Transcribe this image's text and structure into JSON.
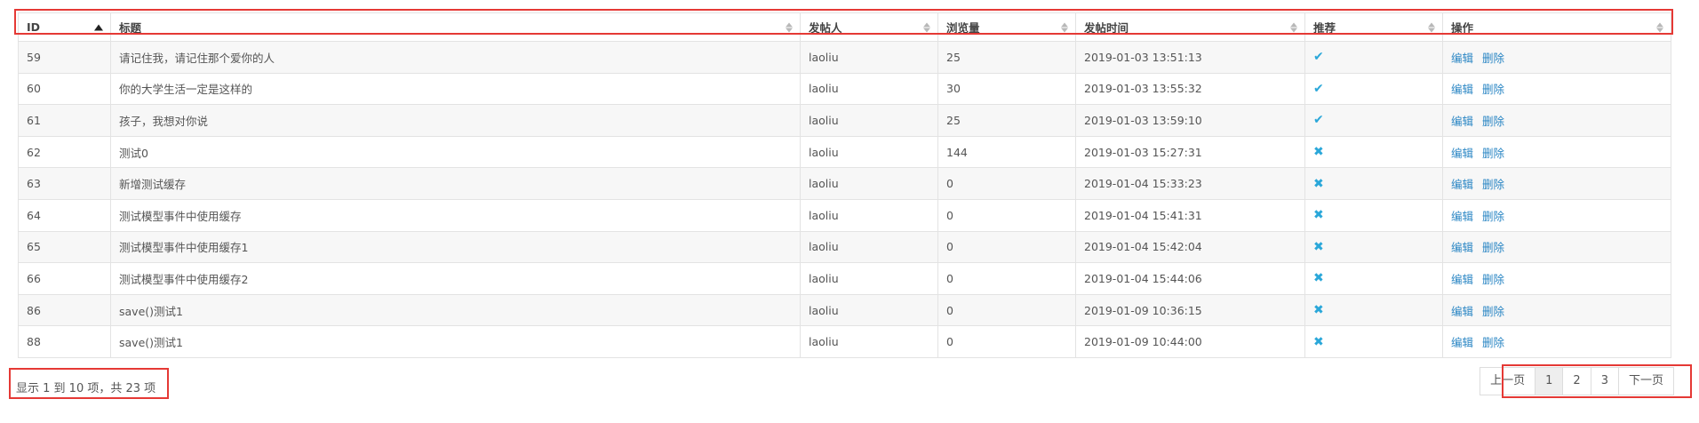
{
  "table": {
    "columns": [
      {
        "label": "ID",
        "sort": "asc"
      },
      {
        "label": "标题",
        "sort": "both"
      },
      {
        "label": "发帖人",
        "sort": "both"
      },
      {
        "label": "浏览量",
        "sort": "both"
      },
      {
        "label": "发帖时间",
        "sort": "both"
      },
      {
        "label": "推荐",
        "sort": "both"
      },
      {
        "label": "操作",
        "sort": "both"
      }
    ],
    "rows": [
      {
        "id": "59",
        "title": "请记住我，请记住那个爱你的人",
        "author": "laoliu",
        "views": "25",
        "time": "2019-01-03 13:51:13",
        "recommended": true
      },
      {
        "id": "60",
        "title": "你的大学生活一定是这样的",
        "author": "laoliu",
        "views": "30",
        "time": "2019-01-03 13:55:32",
        "recommended": true
      },
      {
        "id": "61",
        "title": "孩子，我想对你说",
        "author": "laoliu",
        "views": "25",
        "time": "2019-01-03 13:59:10",
        "recommended": true
      },
      {
        "id": "62",
        "title": "测试0",
        "author": "laoliu",
        "views": "144",
        "time": "2019-01-03 15:27:31",
        "recommended": false
      },
      {
        "id": "63",
        "title": "新增测试缓存",
        "author": "laoliu",
        "views": "0",
        "time": "2019-01-04 15:33:23",
        "recommended": false
      },
      {
        "id": "64",
        "title": "测试模型事件中使用缓存",
        "author": "laoliu",
        "views": "0",
        "time": "2019-01-04 15:41:31",
        "recommended": false
      },
      {
        "id": "65",
        "title": "测试模型事件中使用缓存1",
        "author": "laoliu",
        "views": "0",
        "time": "2019-01-04 15:42:04",
        "recommended": false
      },
      {
        "id": "66",
        "title": "测试模型事件中使用缓存2",
        "author": "laoliu",
        "views": "0",
        "time": "2019-01-04 15:44:06",
        "recommended": false
      },
      {
        "id": "86",
        "title": "save()测试1",
        "author": "laoliu",
        "views": "0",
        "time": "2019-01-09 10:36:15",
        "recommended": false
      },
      {
        "id": "88",
        "title": "save()测试1",
        "author": "laoliu",
        "views": "0",
        "time": "2019-01-09 10:44:00",
        "recommended": false
      }
    ],
    "actions": {
      "edit": "编辑",
      "delete": "删除"
    },
    "icons": {
      "yes": "check-icon",
      "no": "x-icon"
    },
    "icon_color": "#2aa7d9",
    "link_color": "#2a86c4"
  },
  "footer": {
    "summary": "显示 1 到 10 项，共 23 项",
    "pagination": {
      "prev": "上一页",
      "pages": [
        "1",
        "2",
        "3"
      ],
      "current": "1",
      "next": "下一页"
    }
  },
  "highlight_color": "#e53935"
}
